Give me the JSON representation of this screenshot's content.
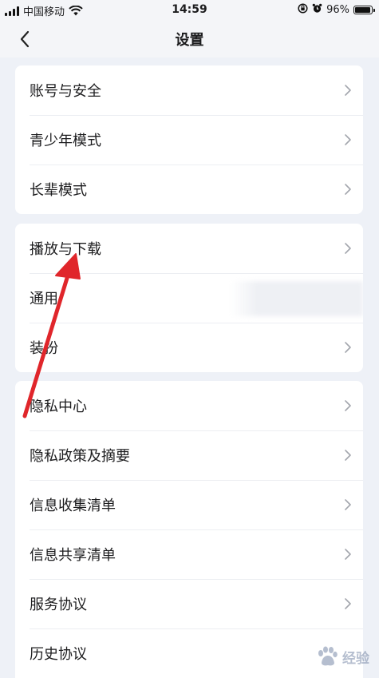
{
  "status_bar": {
    "carrier": "中国移动",
    "time": "14:59",
    "battery_percent": "96%",
    "battery_level": 0.96
  },
  "nav": {
    "title": "设置",
    "back_icon": "chevron-left-icon"
  },
  "groups": [
    {
      "items": [
        {
          "label": "账号与安全"
        },
        {
          "label": "青少年模式"
        },
        {
          "label": "长辈模式"
        }
      ]
    },
    {
      "items": [
        {
          "label": "播放与下载"
        },
        {
          "label": "通用"
        },
        {
          "label": "装扮"
        }
      ]
    },
    {
      "items": [
        {
          "label": "隐私中心"
        },
        {
          "label": "隐私政策及摘要"
        },
        {
          "label": "信息收集清单"
        },
        {
          "label": "信息共享清单"
        },
        {
          "label": "服务协议"
        },
        {
          "label": "历史协议"
        }
      ]
    }
  ],
  "annotation": {
    "type": "red-arrow",
    "points_to": "播放与下载",
    "color": "#e0262b"
  },
  "watermark": {
    "text": "经验"
  }
}
